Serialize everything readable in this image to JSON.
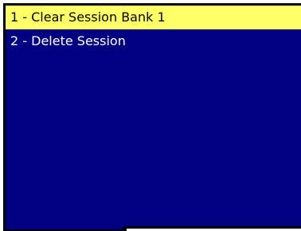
{
  "menu": {
    "items": [
      {
        "label": "1 - Clear Session Bank 1",
        "selected": true
      },
      {
        "label": "2 - Delete Session",
        "selected": false
      }
    ]
  },
  "colors": {
    "panel_background": "#000080",
    "selected_background": "#ffff66",
    "item_text": "#ffffff",
    "selected_text": "#000000"
  }
}
